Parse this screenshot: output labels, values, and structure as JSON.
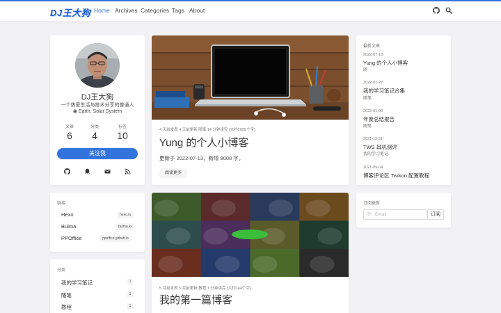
{
  "nav": {
    "logo": "DJ王大狗",
    "items": [
      "Home",
      "Archives",
      "Categories",
      "Tags",
      "About"
    ],
    "active": "Home",
    "icons": [
      "github-icon",
      "search-icon"
    ]
  },
  "profile": {
    "name": "DJ王大狗",
    "bio": "一个热爱生活与技术分享的普通人",
    "location": "Earth, Solar System",
    "stats": [
      {
        "label": "文章",
        "value": "6"
      },
      {
        "label": "分类",
        "value": "4"
      },
      {
        "label": "标签",
        "value": "10"
      }
    ],
    "follow_label": "关注我",
    "social_icons": [
      "github-icon",
      "qq-icon",
      "email-icon",
      "rss-icon"
    ]
  },
  "links": {
    "title": "链接",
    "items": [
      {
        "name": "Hexo",
        "url": "hexo.io"
      },
      {
        "name": "Bulma",
        "url": "bulma.io"
      },
      {
        "name": "PPOffice",
        "url": "ppoffice.github.io"
      }
    ]
  },
  "categories": {
    "title": "分类",
    "items": [
      {
        "name": "我的学习笔记",
        "count": "1"
      },
      {
        "name": "随笔",
        "count": "1"
      },
      {
        "name": "教程",
        "count": "1"
      }
    ]
  },
  "posts": [
    {
      "meta": "4 天前发表   4 天前更新   随笔   14 分钟读完 (大约2095个字)",
      "title": "Yung 的个人小博客",
      "excerpt": "更新于 2022-07-13，新增 8000 字。",
      "read_more": "阅读更多"
    },
    {
      "meta": "5 月前发表   5 月前更新   教程   1 分钟读完 (大约144个字)",
      "title": "我的第一篇博客"
    }
  ],
  "recent": {
    "title": "最新文章",
    "items": [
      {
        "date": "2022-07-13",
        "title": "Yung 的个人小博客",
        "category": "随"
      },
      {
        "date": "2022-01-27",
        "title": "我的学习笔记合集",
        "category": "随笔"
      },
      {
        "date": "2022-01-09",
        "title": "年度总结报告",
        "category": "随笔"
      },
      {
        "date": "2021-12-31",
        "title": "TWS 耳机测评",
        "category": "我的学习笔记"
      },
      {
        "date": "2021-09-04",
        "title": "博客评论区 Twikoo 配置教程",
        "category": ""
      }
    ]
  },
  "subscribe": {
    "title": "订阅更新",
    "placeholder": "Email",
    "button": "订阅"
  },
  "colors": {
    "accent": "#3273dc",
    "background": "#f2f2f5"
  }
}
